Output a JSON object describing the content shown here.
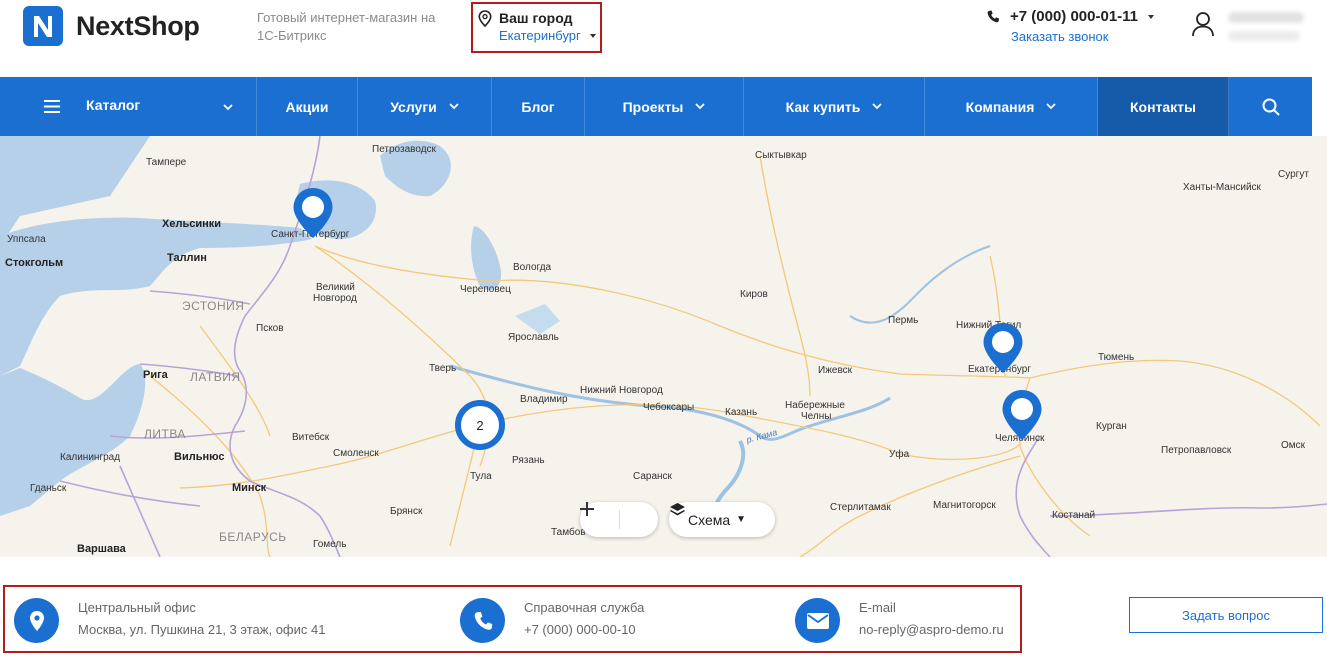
{
  "brand": {
    "name": "NextShop",
    "tagline": "Готовый интернет-магазин на 1С-Битрикс",
    "color": "#1a6fd1"
  },
  "city": {
    "label": "Ваш город",
    "value": "Екатеринбург"
  },
  "contact": {
    "phone": "+7 (000) 000-01-11",
    "callback": "Заказать звонок"
  },
  "nav": {
    "items": [
      {
        "label": "Каталог",
        "dropdown": true,
        "menu": true
      },
      {
        "label": "Акции",
        "dropdown": false
      },
      {
        "label": "Услуги",
        "dropdown": true
      },
      {
        "label": "Блог",
        "dropdown": false
      },
      {
        "label": "Проекты",
        "dropdown": true
      },
      {
        "label": "Как купить",
        "dropdown": true
      },
      {
        "label": "Компания",
        "dropdown": true
      },
      {
        "label": "Контакты",
        "dropdown": false,
        "active": true
      }
    ]
  },
  "map": {
    "labels": [
      {
        "text": "Тампере",
        "cls": ""
      },
      {
        "text": "Петрозаводск",
        "cls": ""
      },
      {
        "text": "Сыктывкар",
        "cls": ""
      },
      {
        "text": "Сургут",
        "cls": ""
      },
      {
        "text": "Ханты-Мансийск",
        "cls": ""
      },
      {
        "text": "Хельсинки",
        "cls": "big"
      },
      {
        "text": "Санкт-Петербург",
        "cls": ""
      },
      {
        "text": "Уппсала",
        "cls": ""
      },
      {
        "text": "Стокгольм",
        "cls": "big"
      },
      {
        "text": "Таллин",
        "cls": "big"
      },
      {
        "text": "Вологда",
        "cls": ""
      },
      {
        "text": "Череповец",
        "cls": ""
      },
      {
        "text": "Великий",
        "cls": ""
      },
      {
        "text": "Новгород",
        "cls": ""
      },
      {
        "text": "ЭСТОНИЯ",
        "cls": "country"
      },
      {
        "text": "Киров",
        "cls": ""
      },
      {
        "text": "Пермь",
        "cls": ""
      },
      {
        "text": "Нижний Тагил",
        "cls": ""
      },
      {
        "text": "Псков",
        "cls": ""
      },
      {
        "text": "Ярославль",
        "cls": ""
      },
      {
        "text": "Тюмень",
        "cls": ""
      },
      {
        "text": "Рига",
        "cls": "big"
      },
      {
        "text": "ЛАТВИЯ",
        "cls": "country"
      },
      {
        "text": "Тверь",
        "cls": ""
      },
      {
        "text": "Ижевск",
        "cls": ""
      },
      {
        "text": "Екатеринбург",
        "cls": ""
      },
      {
        "text": "Нижний Новгород",
        "cls": ""
      },
      {
        "text": "Владимир",
        "cls": ""
      },
      {
        "text": "Чебоксары",
        "cls": ""
      },
      {
        "text": "Казань",
        "cls": ""
      },
      {
        "text": "Набережные",
        "cls": ""
      },
      {
        "text": "Челны",
        "cls": ""
      },
      {
        "text": "ЛИТВА",
        "cls": "country"
      },
      {
        "text": "Витебск",
        "cls": ""
      },
      {
        "text": "Смоленск",
        "cls": ""
      },
      {
        "text": "р. Кама",
        "cls": "river"
      },
      {
        "text": "Челябинск",
        "cls": ""
      },
      {
        "text": "Курган",
        "cls": ""
      },
      {
        "text": "Калининград",
        "cls": ""
      },
      {
        "text": "Вильнюс",
        "cls": "big"
      },
      {
        "text": "Рязань",
        "cls": ""
      },
      {
        "text": "Уфа",
        "cls": ""
      },
      {
        "text": "Омск",
        "cls": ""
      },
      {
        "text": "Петропавловск",
        "cls": ""
      },
      {
        "text": "Гданьск",
        "cls": ""
      },
      {
        "text": "Минск",
        "cls": "big"
      },
      {
        "text": "Тула",
        "cls": ""
      },
      {
        "text": "Саранск",
        "cls": ""
      },
      {
        "text": "Брянск",
        "cls": ""
      },
      {
        "text": "Стерлитамак",
        "cls": ""
      },
      {
        "text": "Магнитогорск",
        "cls": ""
      },
      {
        "text": "Костанай",
        "cls": ""
      },
      {
        "text": "Варшава",
        "cls": "big"
      },
      {
        "text": "БЕЛАРУСЬ",
        "cls": "country"
      },
      {
        "text": "Гомель",
        "cls": ""
      },
      {
        "text": "Тамбов",
        "cls": ""
      }
    ],
    "cluster_count": "2",
    "layer_label": "Схема"
  },
  "info": {
    "office": {
      "title": "Центральный офис",
      "value": "Москва, ул. Пушкина 21, 3 этаж, офис 41"
    },
    "support": {
      "title": "Справочная служба",
      "value": "+7 (000) 000-00-10"
    },
    "email": {
      "title": "E-mail",
      "value": "no-reply@aspro-demo.ru"
    }
  },
  "ask_button": "Задать вопрос"
}
